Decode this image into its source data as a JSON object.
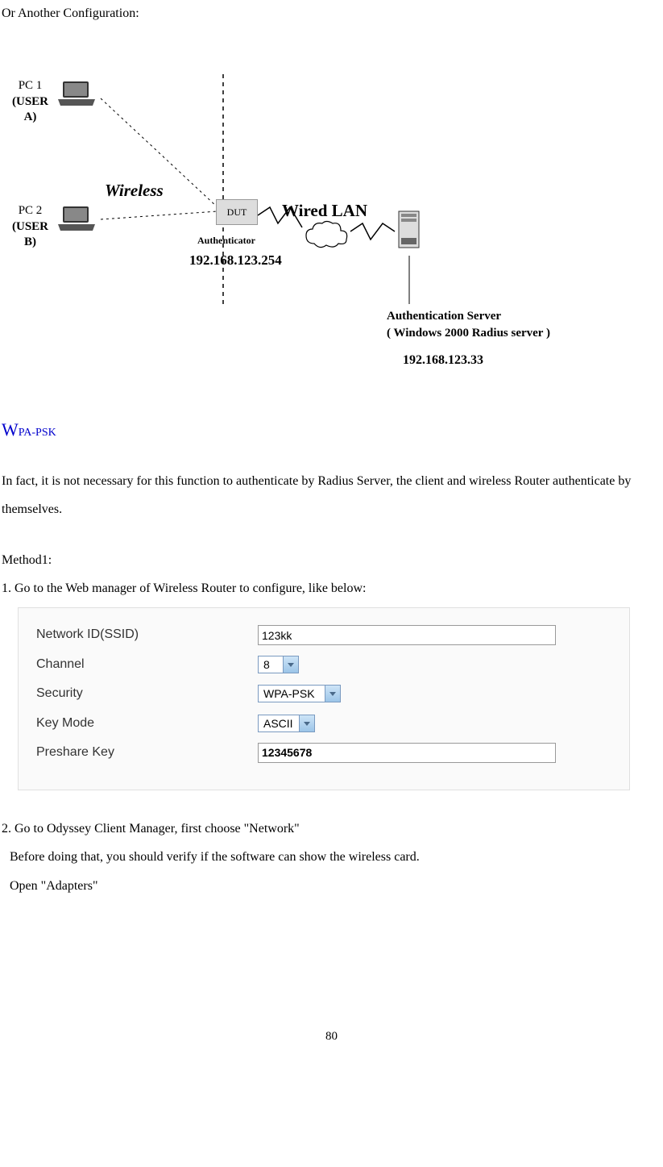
{
  "intro": "Or Another Configuration:",
  "diagram": {
    "pc1_line1": "PC 1",
    "pc1_line2": "(USER A)",
    "pc2_line1": "PC 2",
    "pc2_line2": "(USER B)",
    "wireless": "Wireless",
    "dut": "DUT",
    "authenticator": "Authenticator",
    "ip1": "192.168.123.254",
    "wired_lan": "Wired  LAN",
    "auth_server_line1": "Authentication Server",
    "auth_server_line2": "( Windows 2000 Radius server )",
    "ip2": "192.168.123.33"
  },
  "heading": "WPA-PSK",
  "para1": "In fact, it is not necessary for this function to authenticate by Radius Server, the client and wireless Router authenticate by themselves.",
  "method1": "Method1:",
  "step1": "1. Go to the Web manager of Wireless Router to configure, like below:",
  "config": {
    "ssid_label": "Network ID(SSID)",
    "ssid_value": "123kk",
    "channel_label": "Channel",
    "channel_value": "8",
    "security_label": "Security",
    "security_value": "WPA-PSK",
    "keymode_label": "Key Mode",
    "keymode_value": "ASCII",
    "preshare_label": "Preshare Key",
    "preshare_value": "12345678"
  },
  "step2_line1": "2. Go to Odyssey Client Manager, first choose \"Network\"",
  "step2_line2": "Before doing that, you should verify if the software can show the wireless card.",
  "step2_line3": "Open \"Adapters\"",
  "page_number": "80"
}
